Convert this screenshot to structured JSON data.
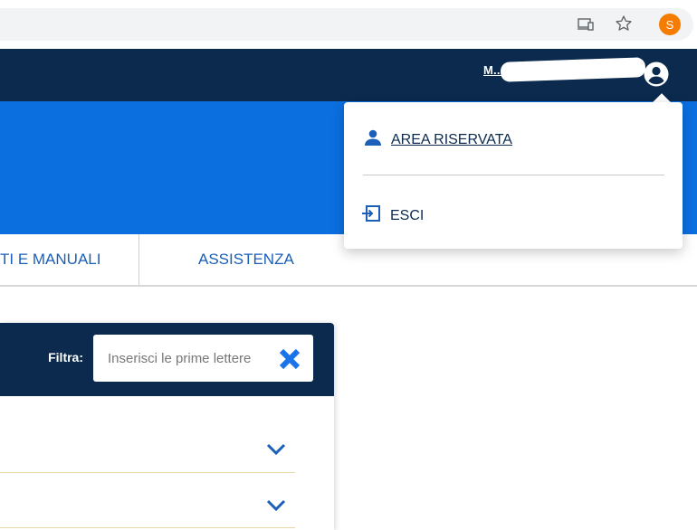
{
  "browser": {
    "icons": {
      "cast": "cast-icon",
      "bookmark": "star-icon"
    },
    "profile_initial": "S",
    "profile_color": "#f57c00"
  },
  "header": {
    "user_name": "M...",
    "user_icon": "account-circle-icon"
  },
  "user_menu": {
    "items": [
      {
        "label": "AREA RISERVATA",
        "icon": "person-icon"
      },
      {
        "label": "ESCI",
        "icon": "logout-icon"
      }
    ]
  },
  "nav": {
    "items": [
      {
        "label": "TI E MANUALI"
      },
      {
        "label": "ASSISTENZA"
      }
    ]
  },
  "filter": {
    "label": "Filtra:",
    "placeholder": "Inserisci le prime lettere",
    "value": "",
    "clear_icon": "close-icon"
  },
  "colors": {
    "header_navy": "#0b2a4e",
    "band_blue": "#0b6fe0",
    "link_blue": "#1b5fb8",
    "clear_icon": "#1a73e8"
  }
}
